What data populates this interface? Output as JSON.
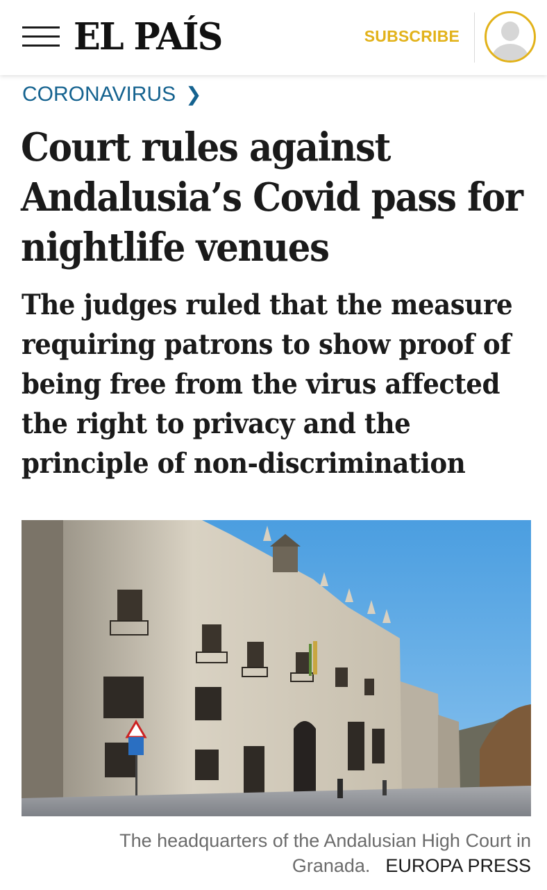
{
  "header": {
    "logo": "EL PAÍS",
    "subscribe_label": "SUBSCRIBE",
    "accent_color": "#e2b21a"
  },
  "article": {
    "section": "CORONAVIRUS",
    "section_color": "#14628f",
    "headline": "Court rules against Andalusia’s Covid pass for nightlife venues",
    "subheadline": "The judges ruled that the measure requiring patrons to show proof of being free from the virus affected the right to privacy and the principle of non-discrimination",
    "photo": {
      "caption": "The headquarters of the Andalusian High Court in Granada.",
      "credit": "EUROPA PRESS"
    }
  },
  "icons": {
    "menu": "hamburger-menu-icon",
    "section_arrow": "chevron-right-icon",
    "user": "user-avatar-icon"
  }
}
